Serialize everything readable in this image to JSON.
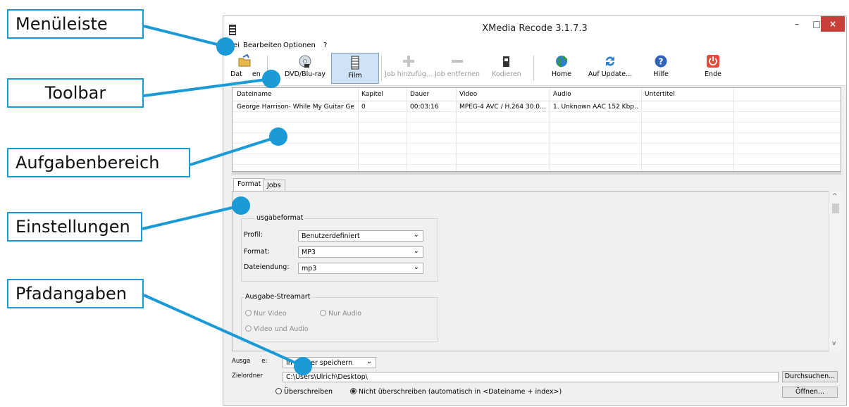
{
  "annotations": {
    "menubar": "Menüleiste",
    "toolbar": "Toolbar",
    "task_area": "Aufgabenbereich",
    "settings": "Einstellungen",
    "paths": "Pfadangaben"
  },
  "window": {
    "title": "XMedia Recode 3.1.7.3",
    "min": "–",
    "max": "□",
    "close": "×"
  },
  "menu": [
    "atei",
    "Bearbeiten",
    "Optionen",
    "?"
  ],
  "toolbar": {
    "open_partial": "Dat",
    "open_tail": "en",
    "dvd": "DVD/Blu-ray",
    "film": "Film",
    "add_job": "Job hinzufüg...",
    "remove_job": "Job entfernen",
    "encode": "Kodieren",
    "home": "Home",
    "update": "Auf Update...",
    "help": "Hilfe",
    "exit": "Ende"
  },
  "jobs": {
    "headers": [
      "Dateiname",
      "Kapitel",
      "Dauer",
      "Video",
      "Audio",
      "Untertitel"
    ],
    "row": [
      "George Harrison- While My Guitar Ge...",
      "0",
      "00:03:16",
      "MPEG-4 AVC / H.264 30.0...",
      "1. Unknown AAC  152 Kbp...",
      ""
    ]
  },
  "tabs": {
    "format": "Format",
    "jobs": "Jobs"
  },
  "output_format": {
    "group": "usgabeformat",
    "profile_label": "Profil:",
    "profile_value": "Benutzerdefiniert",
    "format_label": "Format:",
    "format_value": "MP3",
    "ext_label": "Dateiendung:",
    "ext_value": "mp3"
  },
  "stream": {
    "group": "Ausgabe-Streamart",
    "video_only": "Nur Video",
    "audio_only": "Nur Audio",
    "video_audio": "Video und Audio"
  },
  "output": {
    "label": "Ausga",
    "label_tail": "e:",
    "mode": "In Ordner speichern",
    "target_label": "Zielordner",
    "target_path": "C:\\Users\\Ulrich\\Desktop\\",
    "browse": "Durchsuchen...",
    "open": "Öffnen...",
    "overwrite": "Überschreiben",
    "no_overwrite": "Nicht überschreiben (automatisch in <Dateiname + index>)"
  },
  "colors": {
    "accent": "#1a9ad6",
    "close": "#c7403a",
    "active_tool": "#cfe2f6"
  }
}
